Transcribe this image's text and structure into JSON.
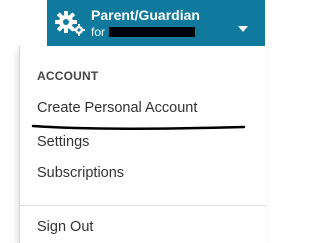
{
  "account_button": {
    "title": "Parent/Guardian",
    "subtitle_prefix": "for",
    "icon": "gears-icon",
    "caret_icon": "caret-down-icon",
    "color": "#0f7a9e"
  },
  "menu": {
    "section_header": "ACCOUNT",
    "items": [
      {
        "label": "Create Personal Account"
      },
      {
        "label": "Settings"
      },
      {
        "label": "Subscriptions"
      }
    ],
    "footer_items": [
      {
        "label": "Sign Out"
      }
    ]
  }
}
